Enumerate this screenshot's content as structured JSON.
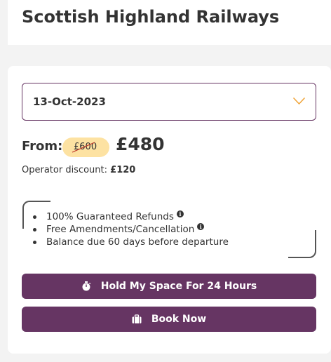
{
  "header": {
    "title": "Scottish Highland Railways"
  },
  "booking": {
    "date_select": {
      "value": "13-Oct-2023",
      "icon": "chevron-down-icon"
    },
    "price": {
      "from_label": "From:",
      "original_price": "£600",
      "current_price": "£480"
    },
    "discount": {
      "label": "Operator discount:",
      "amount": "£120"
    },
    "features": [
      {
        "text": "100% Guaranteed Refunds",
        "has_info": true
      },
      {
        "text": "Free Amendments/Cancellation",
        "has_info": true
      },
      {
        "text": "Balance due 60 days before departure",
        "has_info": false
      }
    ],
    "info_icon_glyph": "i",
    "buttons": {
      "hold_label": "Hold My Space For 24 Hours",
      "hold_icon": "stopwatch-icon",
      "book_label": "Book Now",
      "book_icon": "suitcase-icon"
    }
  },
  "colors": {
    "brand_purple": "#663563",
    "badge_yellow": "#fde2a2",
    "chevron_orange": "#f0a63c",
    "strike_red": "#c0392b",
    "text": "#333333",
    "background": "#f3f3f3"
  }
}
